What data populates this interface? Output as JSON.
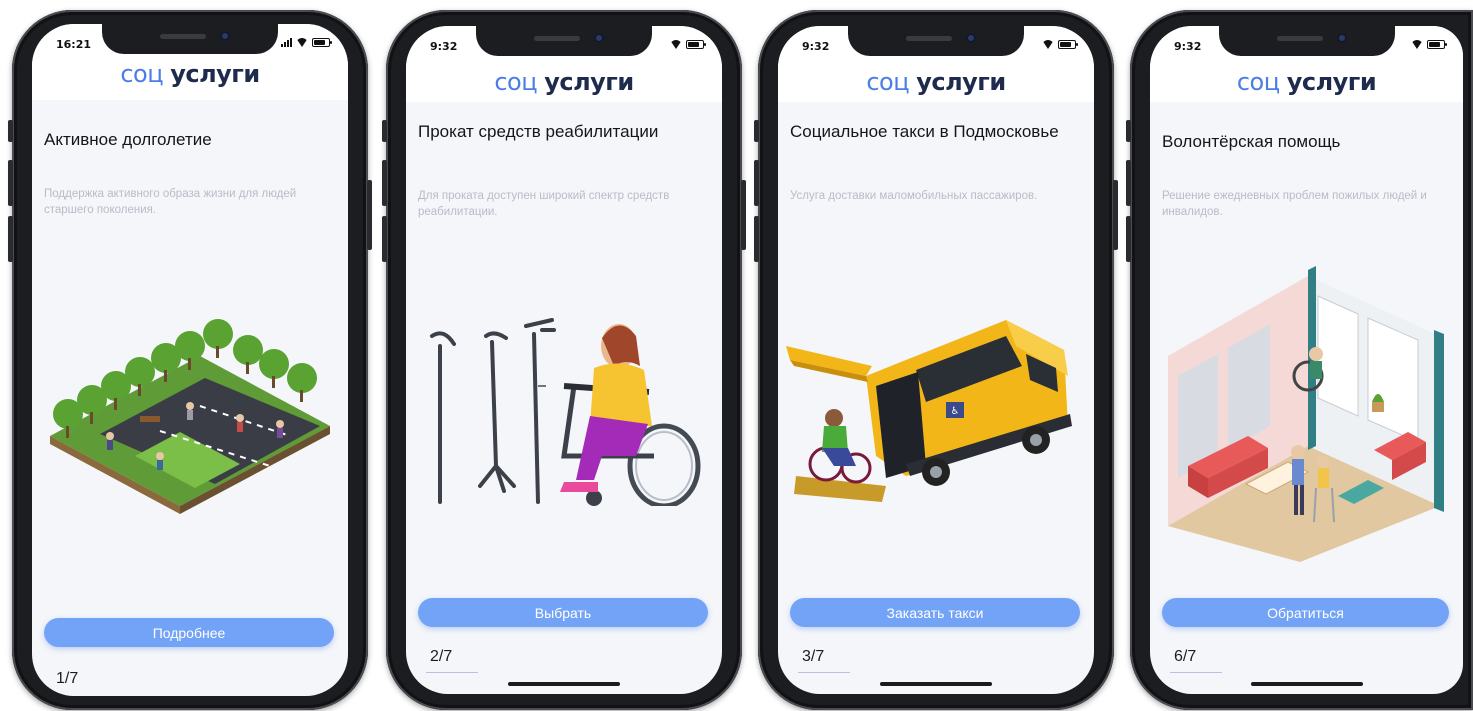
{
  "app": {
    "logo_part1": "соц",
    "logo_part2": "услуги"
  },
  "colors": {
    "accent": "#73a3f6",
    "logo_blue": "#4b7de8",
    "logo_dark": "#1e2b4d",
    "background": "#f4f6fa",
    "description": "#b8bcc6"
  },
  "screens": [
    {
      "time": "16:21",
      "title": "Активное долголетие",
      "description": "Поддержка активного образа жизни для людей старшего поколения.",
      "button": "Подробнее",
      "pager": "1/7",
      "illustration_icon": "park-icon"
    },
    {
      "time": "9:32",
      "title": "Прокат средств реабилитации",
      "description": "Для проката доступен широкий спектр средств реабилитации.",
      "button": "Выбрать",
      "pager": "2/7",
      "illustration_icon": "wheelchair-icon"
    },
    {
      "time": "9:32",
      "title": "Социальное такси в Подмосковье",
      "description": "Услуга доставки маломобильных пассажиров.",
      "button": "Заказать такси",
      "pager": "3/7",
      "illustration_icon": "taxi-van-icon"
    },
    {
      "time": "9:32",
      "title": "Волонтёрская помощь",
      "description": "Решение ежедневных проблем пожилых людей и инвалидов.",
      "button": "Обратиться",
      "pager": "6/7",
      "illustration_icon": "room-icon"
    }
  ]
}
